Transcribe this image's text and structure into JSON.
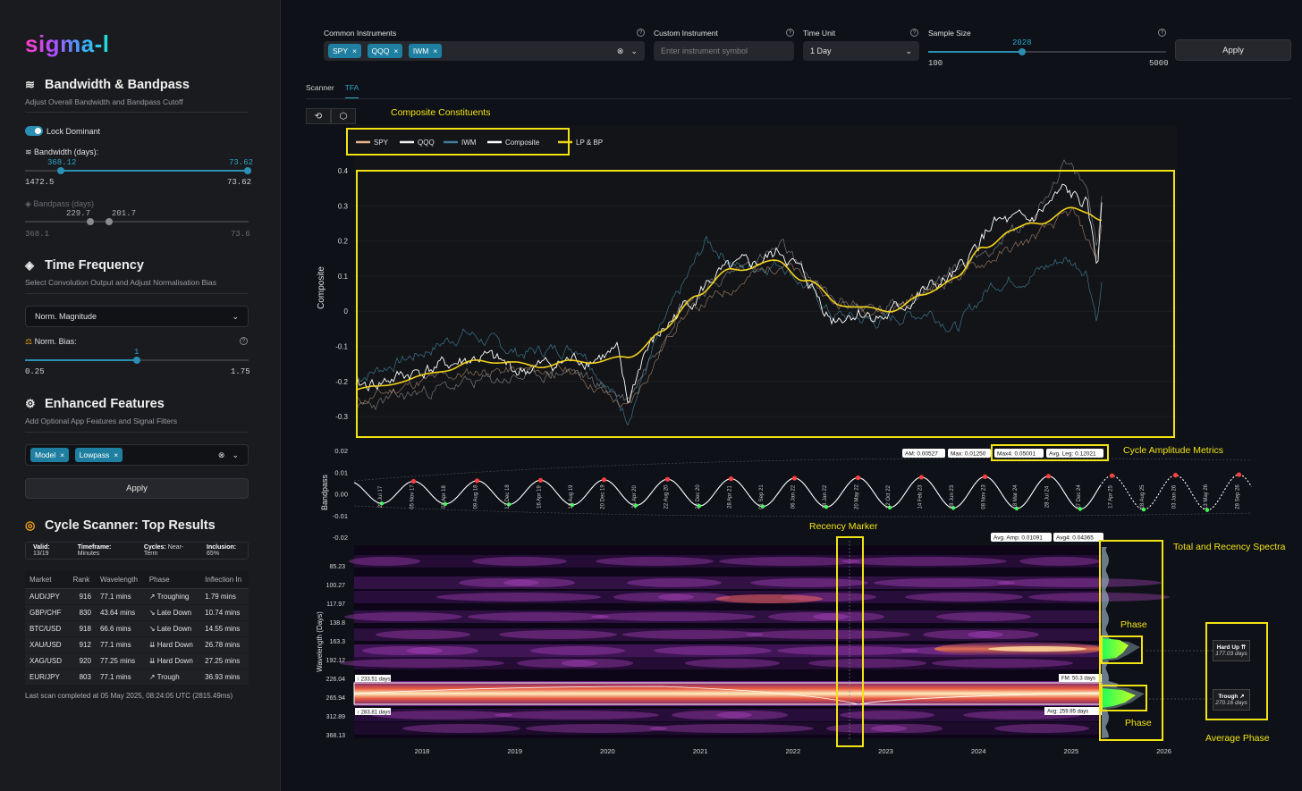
{
  "sidebar": {
    "logo": "sigma-l",
    "bandwidth": {
      "title": "Bandwidth & Bandpass",
      "subtitle": "Adjust Overall Bandwidth and Bandpass Cutoff",
      "lock_label": "Lock Dominant",
      "lock_on": true,
      "bw_label": "Bandwidth (days):",
      "bw_low_val": "368.12",
      "bw_high_val": "73.62",
      "bw_min": "1472.5",
      "bw_max": "73.62",
      "bp_label": "Bandpass (days)",
      "bp_low_val": "229.7",
      "bp_high_val": "201.7",
      "bp_min": "368.1",
      "bp_max": "73.6"
    },
    "timefreq": {
      "title": "Time Frequency",
      "subtitle": "Select Convolution Output and Adjust Normalisation Bias",
      "select_value": "Norm. Magnitude",
      "bias_label": "Norm. Bias:",
      "bias_value": "1",
      "bias_min": "0.25",
      "bias_max": "1.75"
    },
    "enhanced": {
      "title": "Enhanced Features",
      "subtitle": "Add Optional App Features and Signal Filters",
      "chips": [
        "Model",
        "Lowpass"
      ],
      "apply_label": "Apply"
    },
    "scanner": {
      "title": "Cycle Scanner: Top Results",
      "valid_k": "Valid:",
      "valid_v": "13/19",
      "tf_k": "Timeframe:",
      "tf_v": "Minutes",
      "cycles_k": "Cycles:",
      "cycles_v": "Near-Term",
      "incl_k": "Inclusion:",
      "incl_v": "65%",
      "headers": [
        "Market",
        "Rank",
        "Wavelength",
        "Phase",
        "Inflection In"
      ],
      "rows": [
        [
          "AUD/JPY",
          "916",
          "77.1 mins",
          "↗ Troughing",
          "1.79 mins"
        ],
        [
          "GBP/CHF",
          "830",
          "43.64 mins",
          "↘ Late Down",
          "10.74 mins"
        ],
        [
          "BTC/USD",
          "918",
          "66.6 mins",
          "↘ Late Down",
          "14.55 mins"
        ],
        [
          "XAU/USD",
          "912",
          "77.1 mins",
          "⇊ Hard Down",
          "26.78 mins"
        ],
        [
          "XAG/USD",
          "920",
          "77.25 mins",
          "⇊ Hard Down",
          "27.25 mins"
        ],
        [
          "EUR/JPY",
          "803",
          "77.1 mins",
          "↗ Trough",
          "36.93 mins"
        ]
      ],
      "last_scan": "Last scan completed at 05 May 2025, 08:24:05 UTC (2815.49ms)"
    }
  },
  "topbar": {
    "common_label": "Common Instruments",
    "common_chips": [
      "SPY",
      "QQQ",
      "IWM"
    ],
    "custom_label": "Custom Instrument",
    "custom_placeholder": "Enter instrument symbol",
    "timeunit_label": "Time Unit",
    "timeunit_value": "1 Day",
    "sample_label": "Sample Size",
    "sample_value": "2028",
    "sample_value_num": 2028,
    "sample_min": "100",
    "sample_max": "5000",
    "apply_label": "Apply"
  },
  "tabs": [
    "Scanner",
    "TFA"
  ],
  "active_tab": "TFA",
  "annotations": {
    "composite_constituents": "Composite Constituents",
    "cycle_amplitude_metrics": "Cycle Amplitude Metrics",
    "recency_marker": "Recency Marker",
    "total_recency_spectra": "Total and Recency Spectra",
    "phase_top": "Phase",
    "phase_bottom": "Phase",
    "average_phase": "Average Phase"
  },
  "legend": [
    {
      "name": "SPY",
      "color": "#e8b48a"
    },
    {
      "name": "QQQ",
      "color": "#f0f0f0"
    },
    {
      "name": "IWM",
      "color": "#3f7f9a"
    },
    {
      "name": "Composite",
      "color": "#ffffff"
    },
    {
      "name": "LP & BP",
      "color": "#f2d21a"
    }
  ],
  "composite_chart": {
    "ylabel": "Composite",
    "y_ticks": [
      "0.4",
      "0.3",
      "0.2",
      "0.1",
      "0",
      "-0.1",
      "-0.2",
      "-0.3"
    ]
  },
  "bandpass_chart": {
    "ylabel": "Bandpass",
    "y_ticks": [
      "0.02",
      "0.01",
      "0.00",
      "-0.01",
      "-0.02"
    ],
    "metrics": {
      "am": "AM: 0.00527",
      "max": "Max: 0.01250",
      "max4": "Max4: 0.05001",
      "avg_leg": "Avg. Leg: 0.12021",
      "avg_amp": "Avg. Amp: 0.01091",
      "avg4": "Avg4: 0.04365"
    },
    "peak_labels": [
      "28 Jul 17",
      "05 Nov 17",
      "05 Apr 18",
      "09 Aug 18",
      "12 Dec 18",
      "16 Apr 19",
      "18 Aug 19",
      "20 Dec 19",
      "21 Apr 20",
      "22 Aug 20",
      "24 Dec 20",
      "28 Apr 21",
      "01 Sep 21",
      "06 Jan 22",
      "18 Jan 22",
      "20 May 22",
      "22 Oct 22",
      "14 Feb 23",
      "28 Jun 23",
      "08 Nov 23",
      "18 Mar 24",
      "28 Jul 24",
      "07 Dec 24",
      "17 Apr 25",
      "28 Aug 25",
      "03 Jan 26",
      "13 May 26",
      "28 Sep 26"
    ]
  },
  "spectrum_chart": {
    "ylabel": "Wavelength (Days)",
    "y_ticks": [
      "85.23",
      "100.27",
      "117.97",
      "138.8",
      "163.3",
      "192.12",
      "226.04",
      "265.94",
      "312.89",
      "368.13"
    ],
    "x_ticks": [
      "2018",
      "2019",
      "2020",
      "2021",
      "2022",
      "2023",
      "2024",
      "2025",
      "2026"
    ],
    "band_top_label": "↕ 233.51 days",
    "band_bottom_label": "↕ 283.81 days",
    "fm_label": "FM: 50.3 days",
    "avg_label": "Avg: 259.95 days"
  },
  "phase_cards": [
    {
      "title": "Hard Up ⇈",
      "value": "177.03 days"
    },
    {
      "title": "Trough ↗",
      "value": "270.16 days"
    }
  ]
}
